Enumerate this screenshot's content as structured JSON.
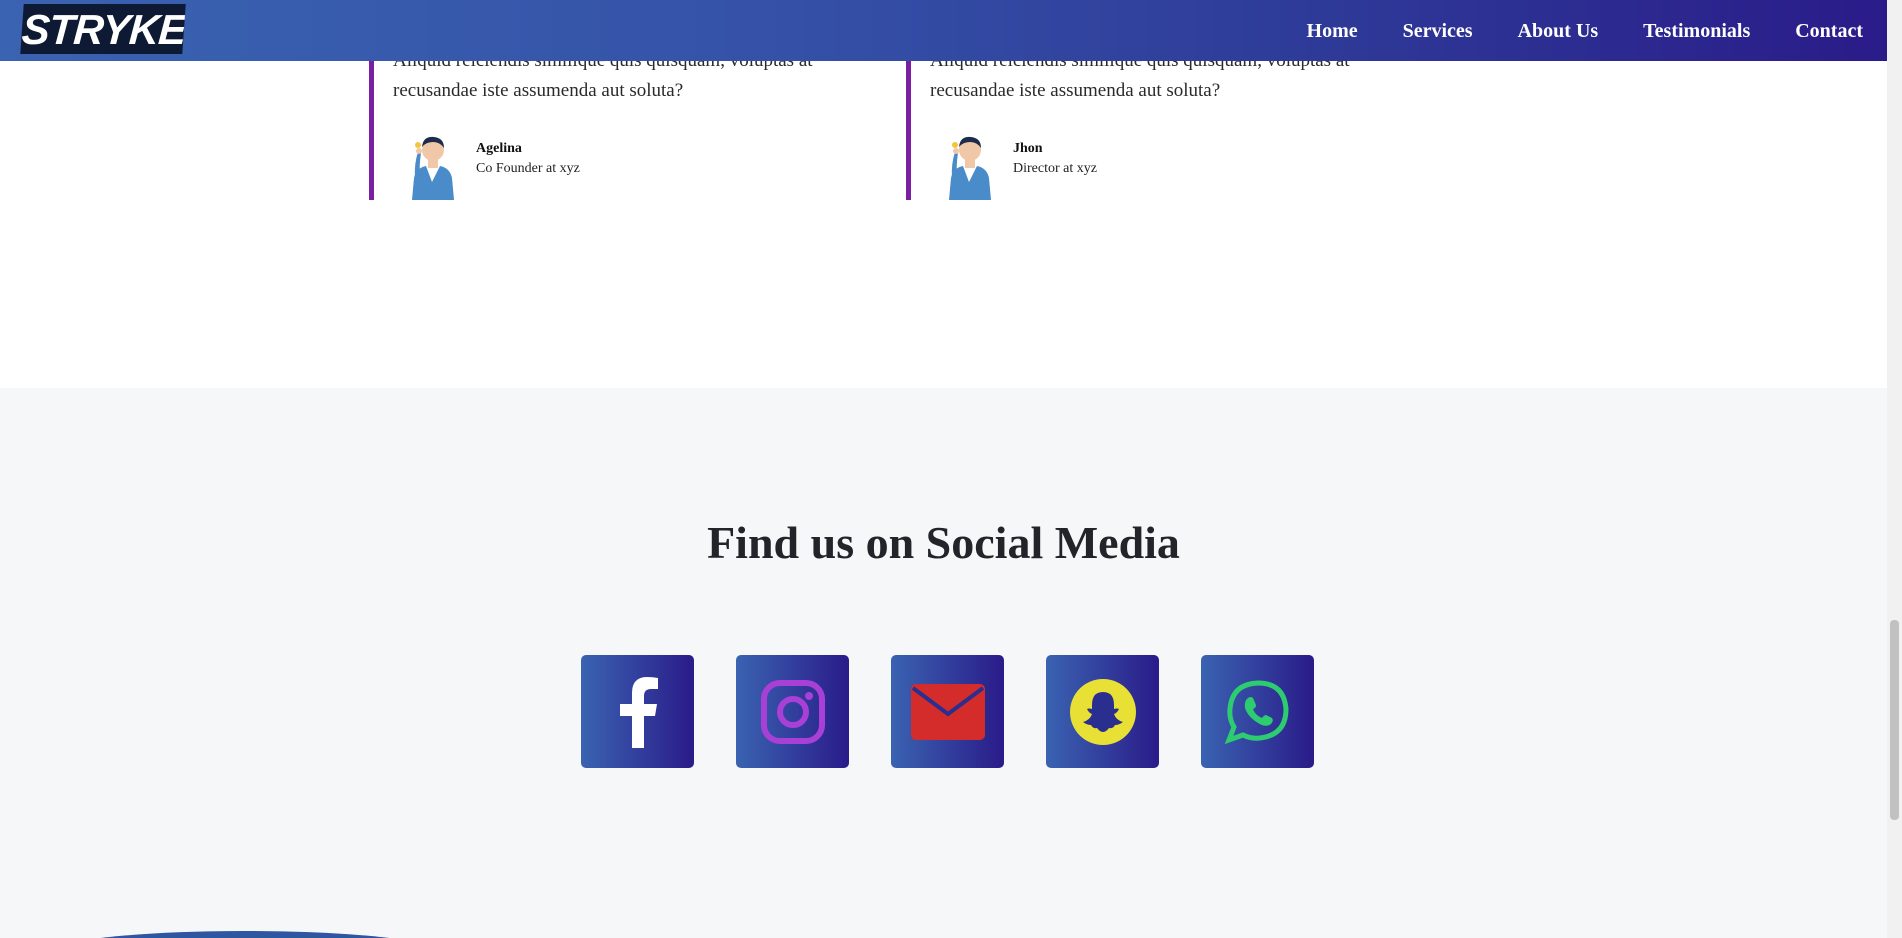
{
  "navbar": {
    "brand": "STRYKER",
    "links": [
      "Home",
      "Services",
      "About Us",
      "Testimonials",
      "Contact"
    ]
  },
  "testimonials": [
    {
      "text": "Aliquid reiciendis similique quis quisquam, voluptas at recusandae iste assumenda aut soluta?",
      "name": "Agelina",
      "role": "Co Founder at xyz"
    },
    {
      "text": "Aliquid reiciendis similique quis quisquam, voluptas at recusandae iste assumenda aut soluta?",
      "name": "Jhon",
      "role": "Director at xyz"
    }
  ],
  "social": {
    "title": "Find us on Social Media",
    "icons": [
      "facebook-icon",
      "instagram-icon",
      "email-icon",
      "snapchat-icon",
      "whatsapp-icon"
    ]
  },
  "colors": {
    "nav_gradient_start": "#3a63b1",
    "nav_gradient_end": "#2a1b89",
    "testimonial_accent": "#7a1fa2",
    "social_bg": "#f6f7f9",
    "instagram": "#a83fd6",
    "email": "#d42b2b",
    "snapchat": "#e8e035",
    "whatsapp": "#2ecc71"
  }
}
